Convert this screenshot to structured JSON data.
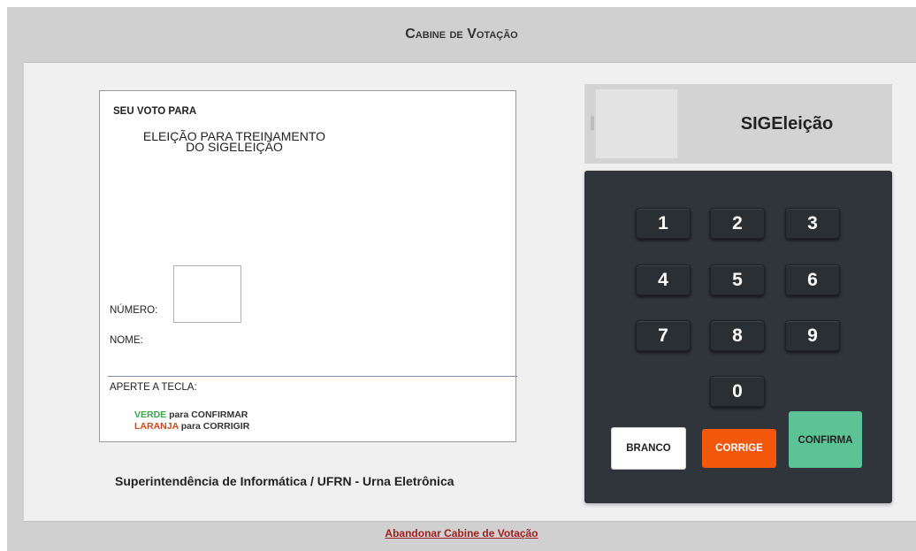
{
  "header": {
    "title": "Cabine de Votação"
  },
  "screen": {
    "seu_voto_label": "SEU VOTO PARA",
    "election_line1": "ELEIÇÃO PARA TREINAMENTO",
    "election_line2": "DO SIGELEIÇÃO",
    "numero_label": "NÚMERO:",
    "numero_value": "",
    "nome_label": "NOME:",
    "aperte_label": "APERTE A TECLA:",
    "verde_word": "VERDE",
    "verde_rest": " para CONFIRMAR",
    "laranja_word": "LARANJA",
    "laranja_rest": " para CORRIGIR"
  },
  "footer_text": "Superintendência de Informática / UFRN - Urna Eletrônica",
  "logo": {
    "text": "SIGEleição"
  },
  "keypad": {
    "keys": [
      "1",
      "2",
      "3",
      "4",
      "5",
      "6",
      "7",
      "8",
      "9",
      "0"
    ],
    "branco_label": "BRANCO",
    "corrige_label": "CORRIGE",
    "confirma_label": "CONFIRMA"
  },
  "colors": {
    "verde": "#3aa64c",
    "laranja": "#d0491d",
    "corrige_button": "#f2570b",
    "confirma_button": "#5bc395",
    "keypad_bg": "#30353b"
  },
  "abandon_link": "Abandonar Cabine de Votação"
}
